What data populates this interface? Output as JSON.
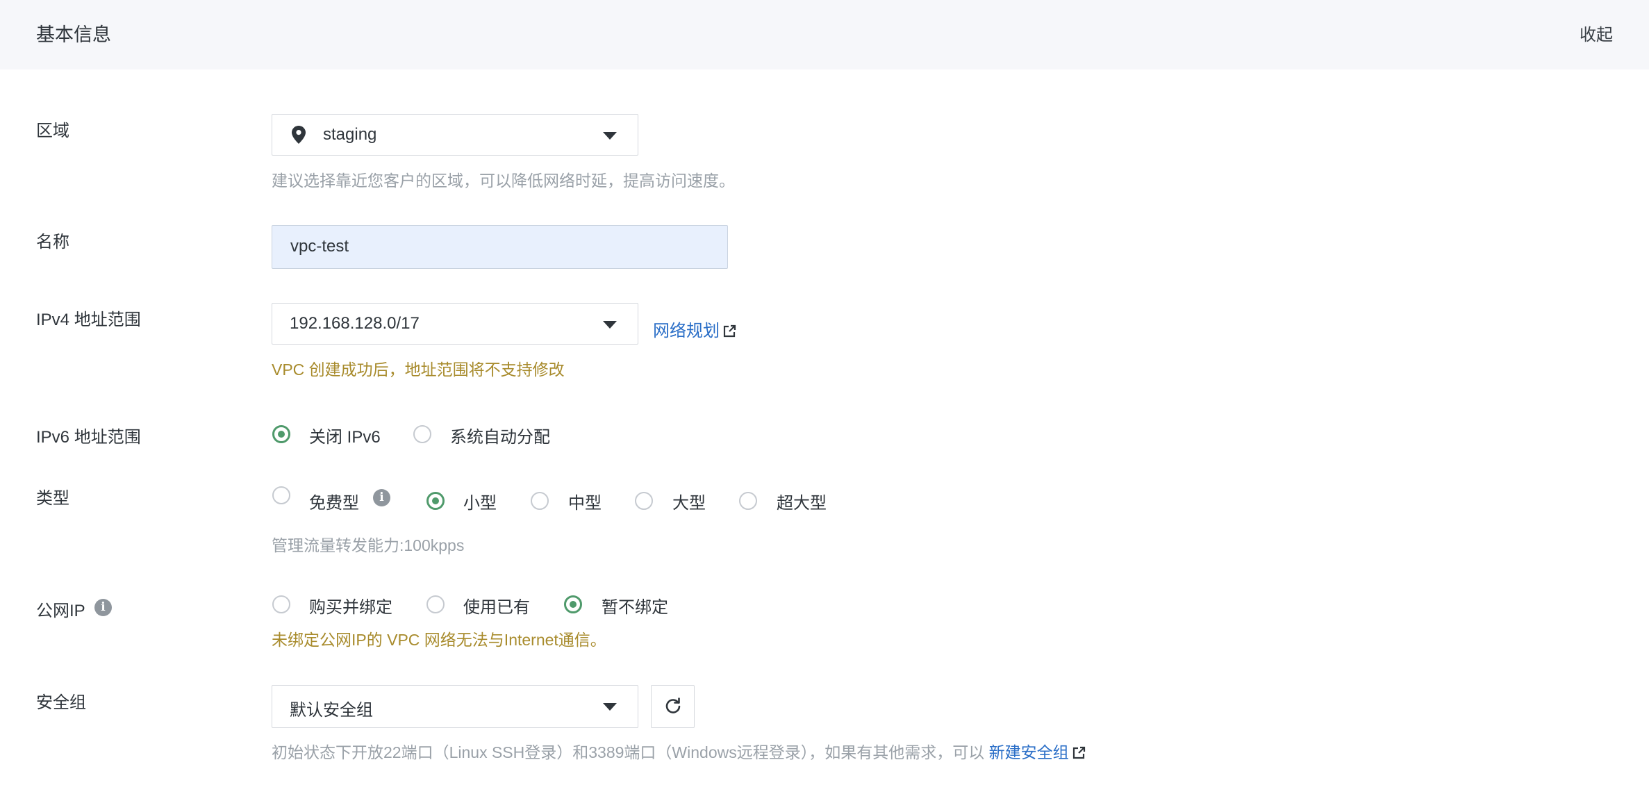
{
  "header": {
    "title": "基本信息",
    "collapse": "收起"
  },
  "region": {
    "label": "区域",
    "value": "staging",
    "hint": "建议选择靠近您客户的区域，可以降低网络时延，提高访问速度。"
  },
  "name": {
    "label": "名称",
    "value": "vpc-test"
  },
  "ipv4": {
    "label": "IPv4 地址范围",
    "value": "192.168.128.0/17",
    "link": "网络规划",
    "warning": "VPC 创建成功后，地址范围将不支持修改"
  },
  "ipv6": {
    "label": "IPv6 地址范围",
    "options": [
      {
        "label": "关闭 IPv6",
        "selected": true
      },
      {
        "label": "系统自动分配",
        "selected": false
      }
    ]
  },
  "type": {
    "label": "类型",
    "options": [
      {
        "label": "免费型",
        "selected": false
      },
      {
        "label": "小型",
        "selected": true
      },
      {
        "label": "中型",
        "selected": false
      },
      {
        "label": "大型",
        "selected": false
      },
      {
        "label": "超大型",
        "selected": false
      }
    ],
    "hint": "管理流量转发能力:100kpps"
  },
  "public_ip": {
    "label": "公网IP",
    "options": [
      {
        "label": "购买并绑定",
        "selected": false
      },
      {
        "label": "使用已有",
        "selected": false
      },
      {
        "label": "暂不绑定",
        "selected": true
      }
    ],
    "warning": "未绑定公网IP的 VPC 网络无法与Internet通信。"
  },
  "security_group": {
    "label": "安全组",
    "value": "默认安全组",
    "hint": "初始状态下开放22端口（Linux SSH登录）和3389端口（Windows远程登录），如果有其他需求，可以",
    "link": "新建安全组"
  },
  "colors": {
    "accent": "#4f9a6b",
    "link": "#2a6ec7",
    "warning": "#a88b2c",
    "input_bg": "#e8f0fd"
  }
}
